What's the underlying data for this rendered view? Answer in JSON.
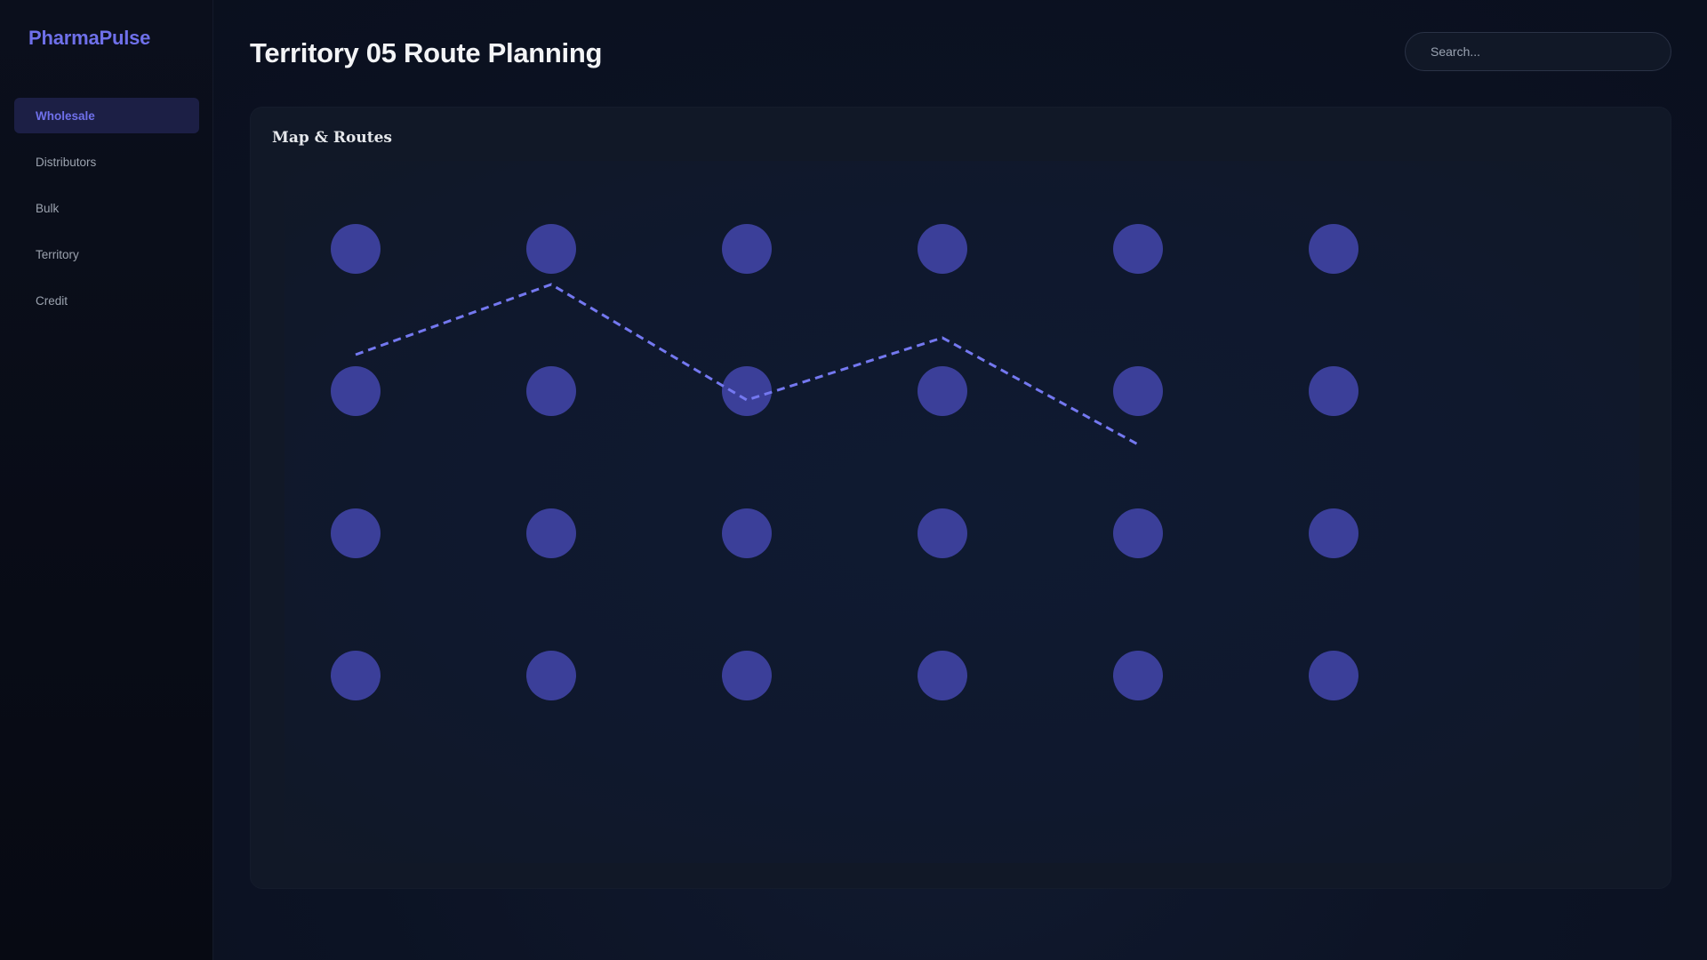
{
  "app": {
    "name": "PharmaPulse"
  },
  "sidebar": {
    "items": [
      {
        "label": "Wholesale",
        "active": true
      },
      {
        "label": "Distributors",
        "active": false
      },
      {
        "label": "Bulk",
        "active": false
      },
      {
        "label": "Territory",
        "active": false
      },
      {
        "label": "Credit",
        "active": false
      }
    ]
  },
  "header": {
    "title": "Territory 05 Route Planning",
    "search_placeholder": "Search..."
  },
  "panel": {
    "title": "Map & Routes"
  },
  "map": {
    "grid_rows": 4,
    "grid_cols": 6,
    "route": {
      "style": "dashed"
    }
  },
  "colors": {
    "accent": "#6f70ea",
    "node": "#3b3f99",
    "route": "#7478f0"
  }
}
